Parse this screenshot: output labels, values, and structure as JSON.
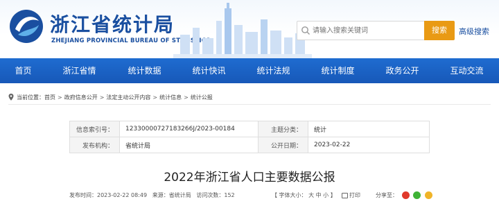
{
  "header": {
    "title": "浙江省统计局",
    "subtitle": "ZHEJIANG PROVINCIAL BUREAU OF STATISTICS"
  },
  "search": {
    "placeholder": "请输入搜索关键词",
    "button_label": "搜索",
    "advanced_label": "高级搜索"
  },
  "nav": {
    "items": [
      "首页",
      "浙江省情",
      "统计数据",
      "统计快讯",
      "统计法规",
      "统计制度",
      "政务公开",
      "互动交流"
    ]
  },
  "breadcrumb": {
    "prefix": "当前位置：",
    "items": [
      "首页",
      "政府信息公开",
      "法定主动公开内容",
      "统计信息",
      "统计公报"
    ],
    "separator": ">"
  },
  "meta": {
    "index_label": "信息索引号：",
    "index_value": "12330000727183266J/2023-00184",
    "category_label": "主题分类：",
    "category_value": "统计",
    "publisher_label": "发布机构：",
    "publisher_value": "省统计局",
    "date_label": "公开日期：",
    "date_value": "2023-02-22"
  },
  "article": {
    "title": "2022年浙江省人口主要数据公报",
    "publish_time": "发布时间：2023-02-22 08:49",
    "source": "来源：省统计局",
    "views": "访问次数：152",
    "font_size_label": "【 字体大小： 大 中 小 】",
    "print_label": "打印",
    "share_label": "分享至："
  },
  "colors": {
    "brand_blue": "#1a4fa0",
    "nav_blue": "#1a62c6",
    "search_orange": "#e99a14"
  }
}
